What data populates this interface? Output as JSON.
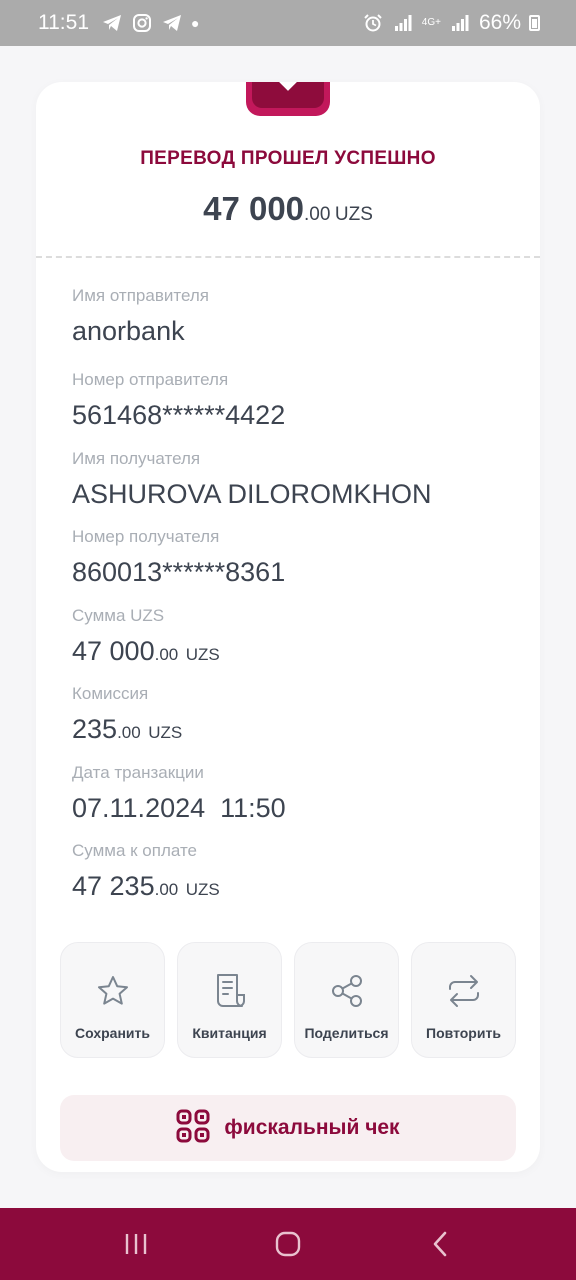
{
  "status_bar": {
    "time": "11:51",
    "network": "4G+",
    "battery": "66%"
  },
  "receipt": {
    "title": "ПЕРЕВОД ПРОШЕЛ УСПЕШНО",
    "amount_int": "47 000",
    "amount_frac": ".00",
    "currency": "UZS",
    "fields": [
      {
        "label": "Имя отправителя",
        "value": "anorbank",
        "frac": "",
        "currency": ""
      },
      {
        "label": "Номер отправителя",
        "value": "561468******4422",
        "frac": "",
        "currency": ""
      },
      {
        "label": "Имя получателя",
        "value": "ASHUROVA DILOROMKHON",
        "frac": "",
        "currency": ""
      },
      {
        "label": "Номер получателя",
        "value": "860013******8361",
        "frac": "",
        "currency": ""
      },
      {
        "label": "Сумма UZS",
        "value": "47 000",
        "frac": ".00",
        "currency": "UZS"
      },
      {
        "label": "Комиссия",
        "value": "235",
        "frac": ".00",
        "currency": "UZS"
      },
      {
        "label": "Дата транзакции",
        "value": "07.11.2024  11:50",
        "frac": "",
        "currency": ""
      },
      {
        "label": "Сумма к оплате",
        "value": "47 235",
        "frac": ".00",
        "currency": "UZS"
      }
    ]
  },
  "actions": [
    {
      "label": "Сохранить",
      "icon": "star-icon"
    },
    {
      "label": "Квитанция",
      "icon": "receipt-icon"
    },
    {
      "label": "Поделиться",
      "icon": "share-icon"
    },
    {
      "label": "Повторить",
      "icon": "repeat-icon"
    }
  ],
  "fiscal_button": {
    "label": "фискальный чек",
    "icon": "qr-code-icon"
  },
  "colors": {
    "brand": "#8c0a3c",
    "brand_light": "#c2185b",
    "text": "#3d4450",
    "muted": "#a9aeb5",
    "fiscal_bg": "#f8eff1"
  }
}
